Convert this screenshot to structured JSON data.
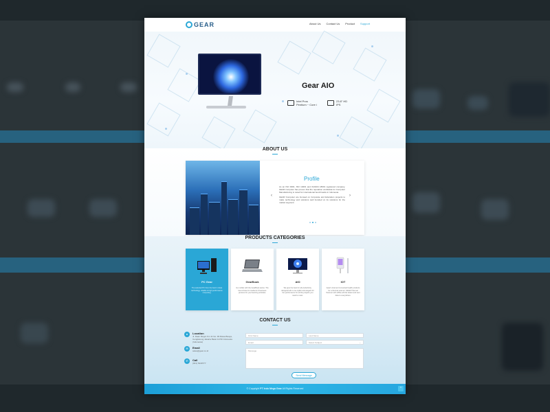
{
  "brand": {
    "logo_text": "GEAR"
  },
  "nav": {
    "items": [
      "About Us",
      "Contact Us",
      "Product",
      "Support"
    ],
    "active_index": 3
  },
  "hero": {
    "title": "Gear AIO",
    "specs": [
      {
        "icon": "cpu-icon",
        "line1": "Intel Pros",
        "line2": "Pentium ~ Core i"
      },
      {
        "icon": "monitor-icon",
        "line1": "23.8\" HD",
        "line2": "IPS"
      }
    ],
    "slide_count": 8,
    "active_slide": 0
  },
  "about": {
    "heading": "ABOUT US",
    "card_title": "Profile",
    "paragraph1": "As an ISO 9001, ISO 14001 and OHSAS 18001 registered company, GEAR computer has proven that the reputation worldwide for Computer Manufacturing is noted for international benchmarks in Indonesia.",
    "paragraph2": "GEAR Computer are focused on Corporate and Education projects to make technology and solutions well founded on its solutions for the market segment.",
    "prev_arrow": "‹",
    "next_arrow": "›"
  },
  "products": {
    "heading": "PRODUCTS CATEGORIES",
    "items": [
      {
        "name": "PC Gear",
        "desc": "The selected PC from the best in class technology, reliable & high performance computing."
      },
      {
        "name": "GearBook",
        "desc": "Go mobile with the GearBook series. The best choice for students & business persons for your learning activities."
      },
      {
        "name": "AIO",
        "desc": "We give the best for all productivity, designed all in one stylish and elegant for the performance for all the projects you need to meet."
      },
      {
        "name": "IOT",
        "desc": "Gear's Internet Connected health products for a thermal scanner. GEAR Thermal Scanner with offline all that detect and sent data to everywhere."
      }
    ],
    "active_index": 0
  },
  "contact": {
    "heading": "CONTACT US",
    "items": [
      {
        "icon": "location-icon",
        "label": "Location",
        "value": "Jl. Daan Mogot Km 11 No. 99 Rawa Buaya, Cengkareng Jakarta Barat 11740 Indonesia (Indonesia)"
      },
      {
        "icon": "email-icon",
        "label": "Email",
        "value": "sales@gear.co.id"
      },
      {
        "icon": "phone-icon",
        "label": "Call",
        "value": "(021) 5449777"
      }
    ],
    "form": {
      "first_name": "First Name",
      "last_name": "Last Name",
      "email": "Email",
      "topic": "Select Subject",
      "message": "Message",
      "send": "Send Message"
    }
  },
  "footer": {
    "copyright_prefix": "© Copyright",
    "company": "PT Indo Mega Gear",
    "suffix": "All Rights Reserved",
    "to_top": "⌃"
  },
  "colors": {
    "accent": "#2aa7d6",
    "footer": "#27a7df",
    "dark_text": "#222222"
  }
}
